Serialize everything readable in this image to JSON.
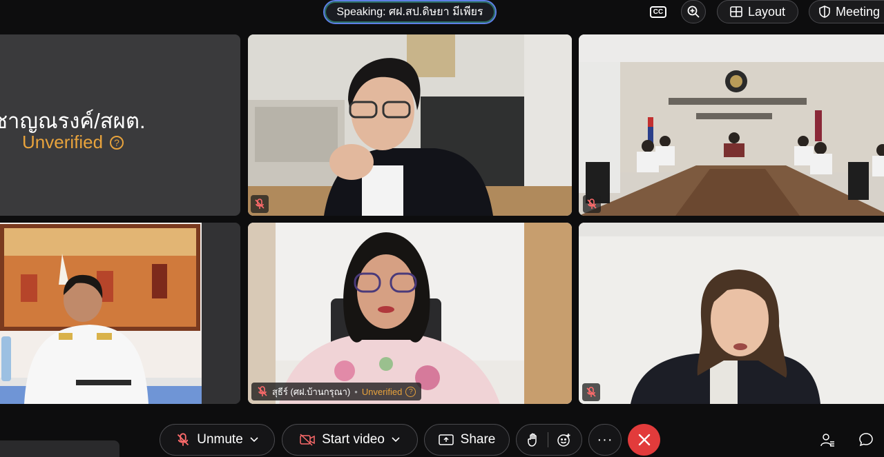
{
  "topbar": {
    "speaking_label": "Speaking: ศฝ.สป.ดิษยา มีเพียร",
    "cc_label": "CC",
    "layout_label": "Layout",
    "meeting_label": "Meeting"
  },
  "tiles": {
    "t1": {
      "name": "ชาญณรงค์/สผต.",
      "status": "Unverified"
    },
    "t5": {
      "name": "สุธีร์ (ศฝ.บ้านกรุณา)",
      "status": "Unverified"
    }
  },
  "controls": {
    "unmute_label": "Unmute",
    "start_video_label": "Start video",
    "share_label": "Share"
  },
  "colors": {
    "accent_unverified": "#e8a33c",
    "end_call": "#e23b3b",
    "speaking_border": "#5d7fe6"
  }
}
